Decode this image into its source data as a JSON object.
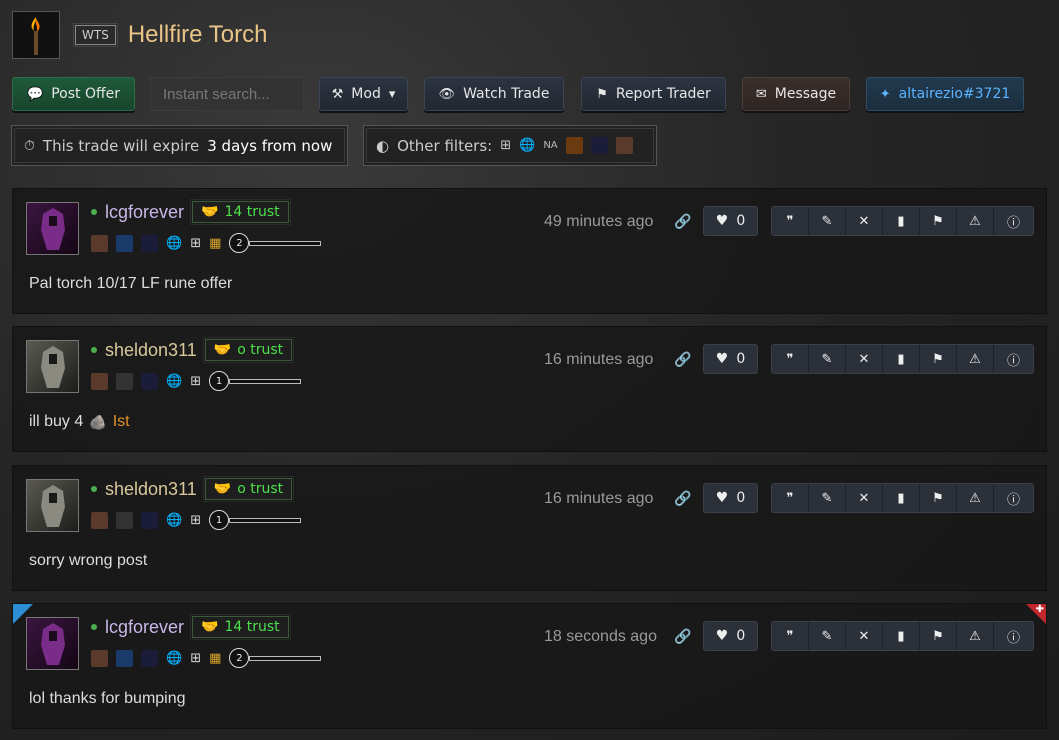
{
  "header": {
    "item_name": "Hellfire Torch",
    "badge": "WTS",
    "item_icon": "torch-icon"
  },
  "toolbar": {
    "post_offer": "Post Offer",
    "search_placeholder": "Instant search...",
    "mod": "Mod",
    "watch_trade": "Watch Trade",
    "report_trader": "Report Trader",
    "message": "Message",
    "contact": "altairezio#3721"
  },
  "info": {
    "expire_prefix": "This trade will expire",
    "expire_value": "3 days from now",
    "filters_label": "Other filters:",
    "region": "NA"
  },
  "colors": {
    "accent_green": "#4ce04c",
    "title_gold": "#e8c486",
    "link_blue": "#5ab4ff",
    "rune_orange": "#e0932a"
  },
  "posts": [
    {
      "username": "lcgforever",
      "trust": "14 trust",
      "level": "2",
      "time": "49 minutes ago",
      "likes": "0",
      "message": "Pal torch 10/17 LF rune offer",
      "rune": ""
    },
    {
      "username": "sheldon311",
      "trust": "o trust",
      "level": "1",
      "time": "16 minutes ago",
      "likes": "0",
      "message": "ill buy 4",
      "rune": "Ist"
    },
    {
      "username": "sheldon311",
      "trust": "o trust",
      "level": "1",
      "time": "16 minutes ago",
      "likes": "0",
      "message": "sorry wrong post",
      "rune": ""
    },
    {
      "username": "lcgforever",
      "trust": "14 trust",
      "level": "2",
      "time": "18 seconds ago",
      "likes": "0",
      "message": "lol thanks for bumping",
      "rune": ""
    }
  ]
}
